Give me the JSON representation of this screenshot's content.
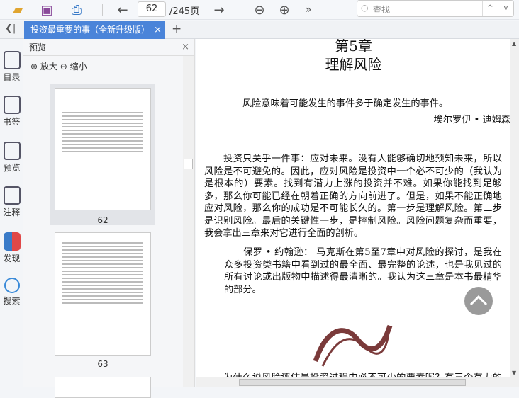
{
  "toolbar": {
    "page_current": "62",
    "page_total": "/245页",
    "more": "»",
    "search_placeholder": "查找",
    "search_prev": "^",
    "search_next": "v"
  },
  "tabs": {
    "collapse": "❮|",
    "active_tab": "投资最重要的事（全新升级版）",
    "close": "×",
    "add": "+"
  },
  "sidenav": [
    {
      "label": "目录"
    },
    {
      "label": "书签"
    },
    {
      "label": "预览"
    },
    {
      "label": "注释"
    },
    {
      "label": "发现"
    },
    {
      "label": "搜索"
    }
  ],
  "preview": {
    "title": "预览",
    "close": "×",
    "zoom_in": "放大",
    "zoom_out": "缩小",
    "pages": [
      "62",
      "63"
    ]
  },
  "document": {
    "chapter": "第5章",
    "title": "理解风险",
    "epigraph": "风险意味着可能发生的事件多于确定发生的事件。",
    "epigraph_author": "埃尔罗伊 • 迪姆森",
    "para1": "投资只关乎一件事：应对未来。没有人能够确切地预知未来，所以风险是不可避免的。因此，应对风险是投资中一个必不可少的（我认为是根本的）要素。找到有潜力上涨的投资并不难。如果你能找到足够多，那么你可能已经在朝着正确的方向前进了。但是，如果不能正确地应对风险，那么你的成功是不可能长久的。第一步是理解风险。第二步是识别风险。最后的关键性一步，是控制风险。风险问题复杂而重要，我会拿出三章来对它进行全面的剖析。",
    "para2": "保罗 • 约翰逊： 马克斯在第5至7章中对风险的探讨，是我在众多投资类书籍中看到过的最全面、最完整的论述，也是我见过的所有讨论或出版物中描述得最清晰的。我认为这三章是本书最精华的部分。",
    "para3": "为什么说风险评估是投资过程中必不可少的要素呢？有三个有力的理由"
  },
  "colors": {
    "accent": "#4a84d9"
  }
}
